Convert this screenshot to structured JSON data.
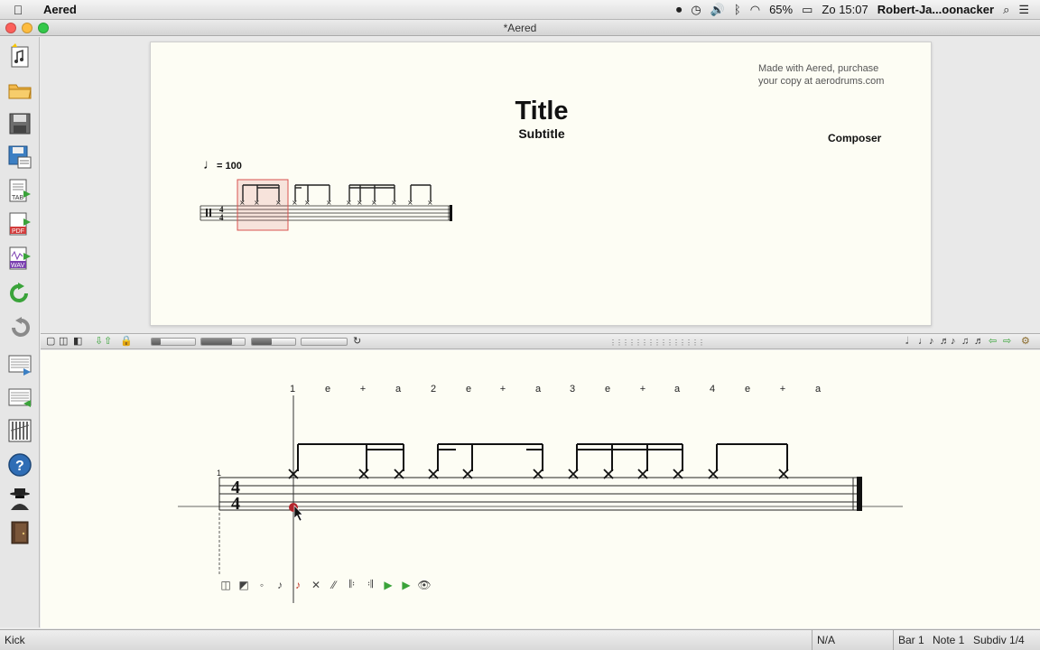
{
  "menubar": {
    "app_name": "Aered",
    "clock": "Zo 15:07",
    "battery": "65%",
    "user": "Robert-Ja...oonacker"
  },
  "window": {
    "title": "*Aered"
  },
  "score_page": {
    "watermark_line1": "Made with Aered, purchase",
    "watermark_line2": "your copy at aerodrums.com",
    "title": "Title",
    "subtitle": "Subtitle",
    "composer": "Composer",
    "tempo": "= 100"
  },
  "editor": {
    "bar_number": "1",
    "counts": [
      "1",
      "e",
      "+",
      "a",
      "2",
      "e",
      "+",
      "a",
      "3",
      "e",
      "+",
      "a",
      "4",
      "e",
      "+",
      "a"
    ]
  },
  "statusbar": {
    "instrument": "Kick",
    "na": "N/A",
    "bar": "Bar 1",
    "note": "Note 1",
    "subdiv": "Subdiv 1/4"
  },
  "toolbar_left": [
    {
      "name": "new-score-icon",
      "glyph": "🎼"
    },
    {
      "name": "open-folder-icon",
      "glyph": "📂"
    },
    {
      "name": "save-icon",
      "glyph": "💾"
    },
    {
      "name": "save-as-icon",
      "glyph": "🖫"
    },
    {
      "name": "export-tab-icon",
      "glyph": "TAB"
    },
    {
      "name": "export-pdf-icon",
      "glyph": "PDF"
    },
    {
      "name": "export-wav-icon",
      "glyph": "WAV"
    },
    {
      "name": "redo-icon",
      "glyph": "↻"
    },
    {
      "name": "undo-icon",
      "glyph": "↺"
    },
    {
      "name": "insert-bar-icon",
      "glyph": "▤"
    },
    {
      "name": "delete-bar-icon",
      "glyph": "▥"
    },
    {
      "name": "drum-kit-icon",
      "glyph": "▦"
    },
    {
      "name": "help-icon",
      "glyph": "?"
    },
    {
      "name": "spy-icon",
      "glyph": "🕵"
    },
    {
      "name": "exit-door-icon",
      "glyph": "🚪"
    }
  ],
  "colors": {
    "selection": "#d9534f",
    "page_bg": "#fdfdf4",
    "cursor_dot": "#b3262d"
  }
}
